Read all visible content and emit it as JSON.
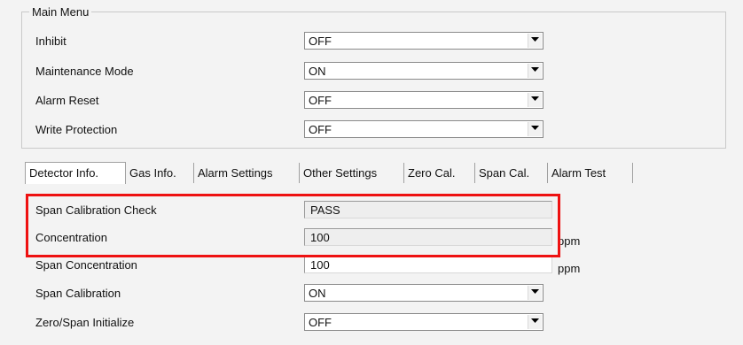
{
  "main_menu": {
    "legend": "Main Menu",
    "rows": [
      {
        "label": "Inhibit",
        "value": "OFF"
      },
      {
        "label": "Maintenance Mode",
        "value": "ON"
      },
      {
        "label": "Alarm Reset",
        "value": "OFF"
      },
      {
        "label": "Write Protection",
        "value": "OFF"
      }
    ]
  },
  "tabs": [
    "Detector Info.",
    "Gas Info.",
    "Alarm Settings",
    "Other Settings",
    "Zero Cal.",
    "Span Cal.",
    "Alarm Test"
  ],
  "active_tab": "Detector Info.",
  "detector": {
    "rows": [
      {
        "label": "Span Calibration Check",
        "value": "PASS",
        "unit": ""
      },
      {
        "label": "Concentration",
        "value": "100",
        "unit": "ppm"
      },
      {
        "label": "Span Concentration",
        "value": "100",
        "unit": "ppm"
      },
      {
        "label": "Span Calibration",
        "value": "ON"
      },
      {
        "label": "Zero/Span Initialize",
        "value": "OFF"
      }
    ]
  },
  "colors": {
    "highlight": "#ee1111",
    "panel": "#f3f3f3"
  },
  "icons": {
    "dropdown": "chevron-down-icon"
  }
}
